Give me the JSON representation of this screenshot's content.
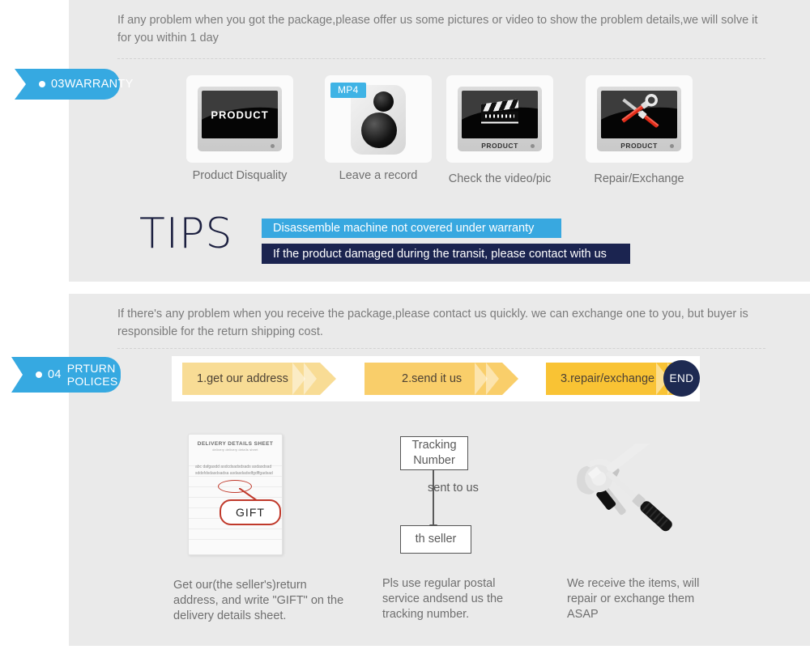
{
  "warranty": {
    "intro": "If any problem when you got the package,please offer us some pictures or video to show the problem details,we will solve it for you within 1 day",
    "badge": {
      "number": "03",
      "label": "WARRANTY"
    },
    "steps": [
      {
        "label": "Product Disquality",
        "screen_text": "PRODUCT",
        "icon": "monitor-product-icon"
      },
      {
        "label": "Leave a record",
        "badge": "MP4",
        "icon": "camera-mp4-icon"
      },
      {
        "label": "Check the video/pic",
        "caption": "PRODUCT",
        "icon": "monitor-clapperboard-icon"
      },
      {
        "label": "Repair/Exchange",
        "caption": "PRODUCT",
        "icon": "monitor-tools-icon"
      }
    ],
    "arrow_glyph": "→",
    "tips": {
      "heading": "TIPS",
      "bar1": "Disassemble machine not covered under warranty",
      "bar2": "If the product damaged during the transit, please contact with us"
    }
  },
  "returns": {
    "intro": "If  there's any problem when you receive the package,please contact us quickly. we can exchange one to you, but buyer is responsible for the return shipping cost.",
    "badge": {
      "number": "04",
      "line1": "PRTURN",
      "line2": "POLICES"
    },
    "steps": [
      "1.get our address",
      "2.send it us",
      "3.repair/exchange"
    ],
    "end_label": "END",
    "blocks": [
      {
        "icon": "delivery-details-sheet-icon",
        "sheet_title": "DELIVERY DETAILS SHEET",
        "sheet_subtitle": "delivery        delivery details sheet",
        "sheet_body": "abc dafgasdd asdcdsadsdsads asdasdsadsddsfdsdasdsadsa asdasdadsdfgdffgadsad",
        "gift_label": "GIFT",
        "caption": "Get our(the seller's)return address, and write \"GIFT\" on the delivery details sheet."
      },
      {
        "icon": "tracking-flow-icon",
        "box1": "Tracking Number",
        "connector_label": "sent to us",
        "box2": "th seller",
        "caption": "Pls use regular postal service andsend us the tracking number."
      },
      {
        "icon": "hammer-wrench-icon",
        "caption": "We receive the items, will repair or exchange them ASAP"
      }
    ]
  },
  "colors": {
    "accent_blue": "#36a9e1",
    "navy": "#1b2450",
    "panel_bg": "#eaeaea",
    "yellow_light": "#f8dc95",
    "yellow_mid": "#f9ce6a",
    "yellow_dark": "#f9c334",
    "red": "#c0392b"
  }
}
